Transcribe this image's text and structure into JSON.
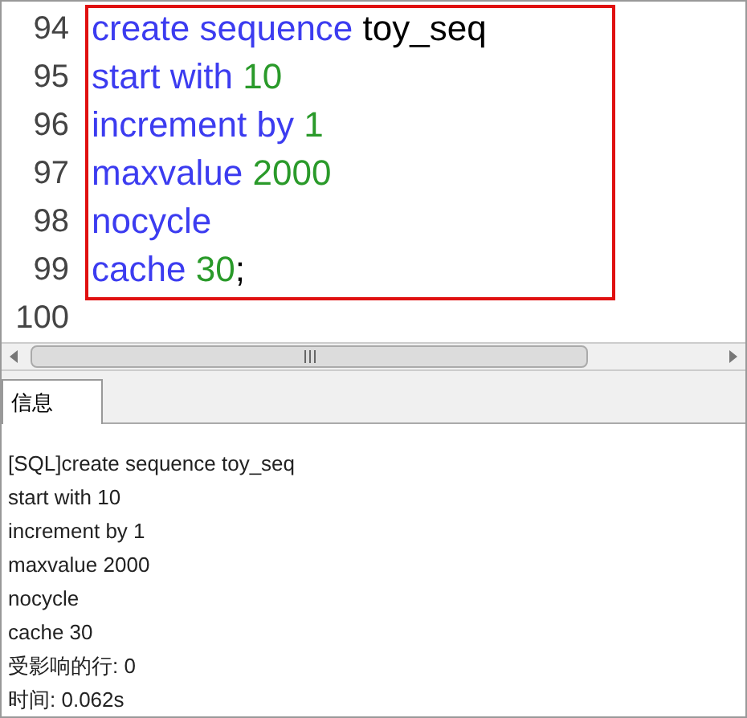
{
  "editor": {
    "lines": [
      {
        "number": "94",
        "tokens": [
          {
            "text": "create sequence ",
            "kind": "keyword"
          },
          {
            "text": "toy_seq",
            "kind": "plain"
          }
        ]
      },
      {
        "number": "95",
        "tokens": [
          {
            "text": "start with ",
            "kind": "keyword"
          },
          {
            "text": "10",
            "kind": "number"
          }
        ]
      },
      {
        "number": "96",
        "tokens": [
          {
            "text": "increment by ",
            "kind": "keyword"
          },
          {
            "text": "1",
            "kind": "number"
          }
        ]
      },
      {
        "number": "97",
        "tokens": [
          {
            "text": "maxvalue ",
            "kind": "keyword"
          },
          {
            "text": "2000",
            "kind": "number"
          }
        ]
      },
      {
        "number": "98",
        "tokens": [
          {
            "text": "nocycle",
            "kind": "keyword"
          }
        ]
      },
      {
        "number": "99",
        "tokens": [
          {
            "text": "cache ",
            "kind": "keyword"
          },
          {
            "text": "30",
            "kind": "number"
          },
          {
            "text": ";",
            "kind": "plain"
          }
        ]
      },
      {
        "number": "100"
      }
    ]
  },
  "tabs": [
    {
      "label": "信息",
      "selected": true
    }
  ],
  "messages": [
    "[SQL]create sequence toy_seq",
    "start with 10",
    "increment by 1",
    "maxvalue 2000",
    "nocycle",
    "cache 30",
    "受影响的行: 0",
    "时间: 0.062s"
  ]
}
